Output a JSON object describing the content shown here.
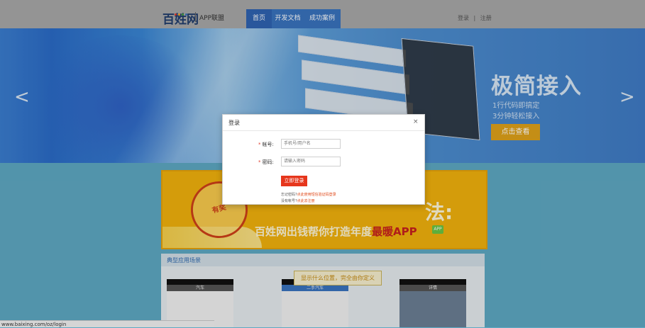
{
  "header": {
    "logo_text": "百姓网",
    "logo_sub": "APP联盟",
    "nav": [
      {
        "label": "首页"
      },
      {
        "label": "开发文档"
      },
      {
        "label": "成功案例"
      }
    ],
    "login": "登录",
    "separator": "|",
    "register": "注册"
  },
  "banner": {
    "title": "极简接入",
    "line1": "1行代码即搞定",
    "line2": "3分钟轻松接入",
    "cta": "点击查看",
    "prev_arrow": "<",
    "next_arrow": ">"
  },
  "promo": {
    "stamp": "有奖",
    "headline": "法:",
    "slogan_prefix": "百姓网出钱帮你打造年度",
    "slogan_highlight": "最暖APP",
    "badge": "APP"
  },
  "scenes": {
    "title": "典型应用场景",
    "callout": "显示什么位置，完全由你定义",
    "phones": [
      {
        "header": "汽车"
      },
      {
        "header": "二手汽车"
      },
      {
        "header": "详情"
      }
    ]
  },
  "modal": {
    "title": "登录",
    "close": "×",
    "account_label": "帐号:",
    "account_placeholder": "手机号/用户名",
    "password_label": "密码:",
    "password_placeholder": "请输入密码",
    "submit": "立即登录",
    "forgot_text": "忘记密码?",
    "forgot_link": "点此使用短信验证码登录",
    "noaccount_text": "没有帐号?",
    "noaccount_link": "点此去注册",
    "required_mark": "*"
  },
  "statusbar": {
    "url": "www.baixing.com/oz/login"
  },
  "colors": {
    "accent": "#3a74bf",
    "cta": "#e0a21a",
    "login_button": "#e6361c",
    "promo": "#f2b20d"
  }
}
